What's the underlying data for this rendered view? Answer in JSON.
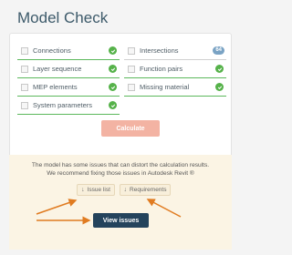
{
  "title": "Model Check",
  "checks": [
    {
      "label": "Connections",
      "status": "ok"
    },
    {
      "label": "Intersections",
      "status": "count",
      "count": "64"
    },
    {
      "label": "Layer sequence",
      "status": "ok"
    },
    {
      "label": "Function pairs",
      "status": "ok"
    },
    {
      "label": "MEP elements",
      "status": "ok"
    },
    {
      "label": "Missing material",
      "status": "ok"
    },
    {
      "label": "System parameters",
      "status": "ok"
    }
  ],
  "calculate_label": "Calculate",
  "info": {
    "line1": "The model has some issues that can distort the calculation results.",
    "line2": "We recommend fixing those issues in Autodesk Revit ®",
    "issue_list_label": "Issue list",
    "requirements_label": "Requirements",
    "view_issues_label": "View issues"
  },
  "colors": {
    "ok": "#56b24a",
    "accent": "#f3b3a3",
    "primary": "#24435c",
    "annotation_arrow": "#e07b20"
  }
}
